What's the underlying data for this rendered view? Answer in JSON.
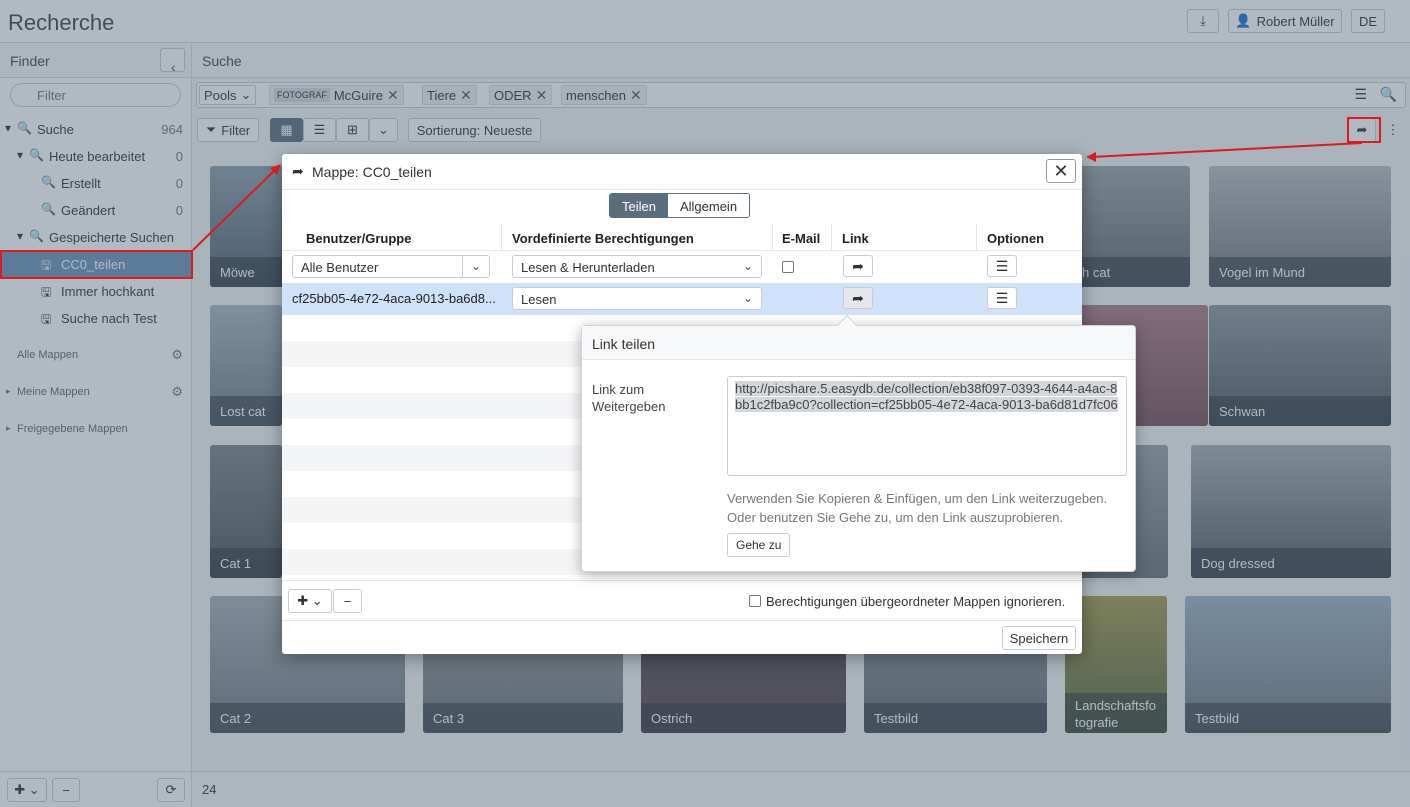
{
  "app": {
    "title": "Recherche",
    "download_icon": "download-icon",
    "user_name": "Robert Müller",
    "lang": "DE"
  },
  "sidebar": {
    "header": "Finder",
    "filter_placeholder": "Filter",
    "tree": [
      {
        "label": "Suche",
        "count": "964"
      },
      {
        "label": "Heute bearbeitet",
        "count": "0"
      },
      {
        "label": "Erstellt",
        "count": "0"
      },
      {
        "label": "Geändert",
        "count": "0"
      },
      {
        "label": "Gespeicherte Suchen",
        "count": ""
      },
      {
        "label": "CC0_teilen",
        "count": ""
      },
      {
        "label": "Immer hochkant",
        "count": ""
      },
      {
        "label": "Suche nach Test",
        "count": ""
      }
    ],
    "sections": [
      "Alle Mappen",
      "Meine Mappen",
      "Freigegebene Mappen"
    ]
  },
  "main": {
    "header": "Suche",
    "search": {
      "pools_label": "Pools",
      "chip_tag": "FOTOGRAF",
      "chips": [
        "McGuire",
        "Tiere",
        "ODER",
        "menschen"
      ]
    },
    "toolbar": {
      "filter_label": "Filter",
      "sort_label": "Sortierung: Neueste"
    },
    "tiles": [
      "Möwe",
      "h cat",
      "Vogel im Mund",
      "Lost cat",
      "Schwan",
      "Cat 1",
      "Dog dressed",
      "Cat 2",
      "Cat 3",
      "Ostrich",
      "Testbild",
      "Landschaftsfo tografie",
      "Testbild"
    ],
    "count": "24"
  },
  "modal": {
    "title": "Mappe: CC0_teilen",
    "tabs": [
      "Teilen",
      "Allgemein"
    ],
    "columns": [
      "Benutzer/Gruppe",
      "Vordefinierte Berechtigungen",
      "E-Mail",
      "Link",
      "Optionen"
    ],
    "rows": [
      {
        "user": "Alle Benutzer",
        "permission": "Lesen & Herunterladen"
      },
      {
        "user": "cf25bb05-4e72-4aca-9013-ba6d8...",
        "permission": "Lesen"
      }
    ],
    "ignore_label": "Berechtigungen übergeordneter Mappen ignorieren.",
    "save_label": "Speichern"
  },
  "popover": {
    "title": "Link teilen",
    "label": "Link zum Weitergeben",
    "url": "http://picshare.5.easydb.de/collection/eb38f097-0393-4644-a4ac-8bb1c2fba9c0?collection=cf25bb05-4e72-4aca-9013-ba6d81d7fc06",
    "help": "Verwenden Sie Kopieren & Einfügen, um den Link weiterzugeben. Oder benutzen Sie Gehe zu, um den Link auszuprobieren.",
    "goto_label": "Gehe zu"
  }
}
